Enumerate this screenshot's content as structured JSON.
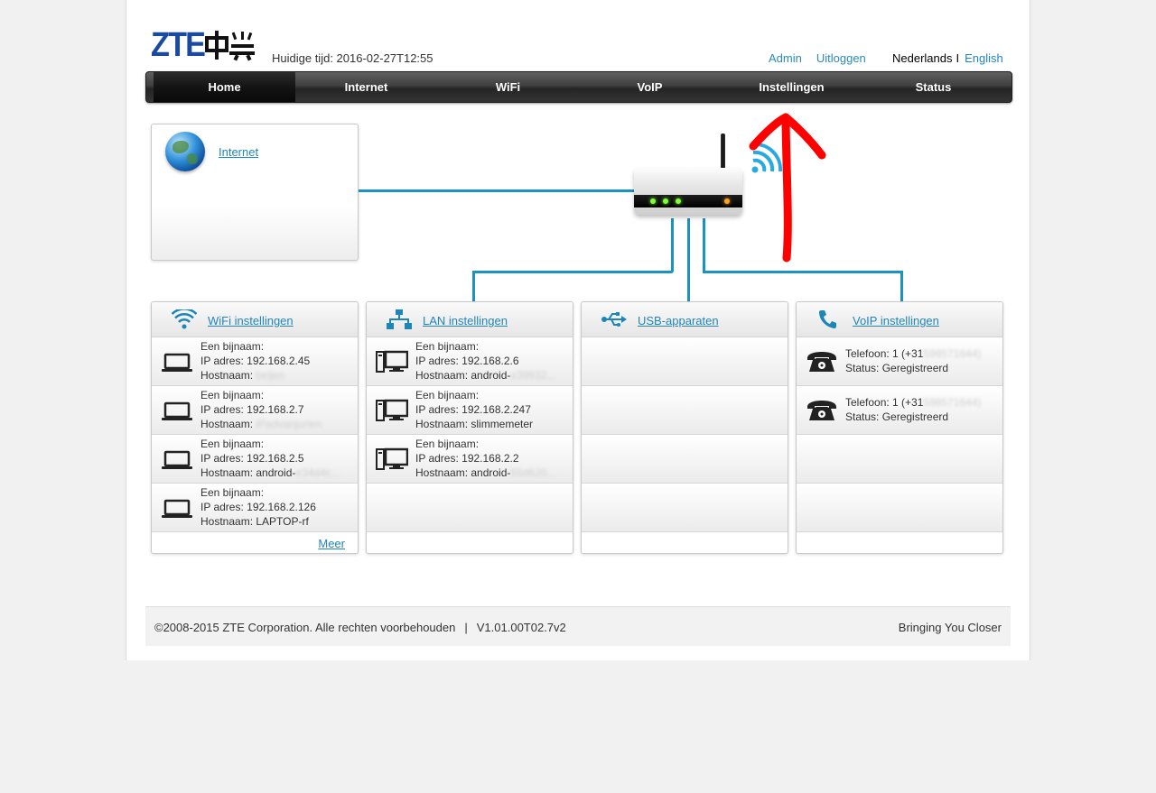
{
  "header": {
    "time": "Huidige tijd: 2016-02-27T12:55",
    "links": [
      "Admin",
      "Uitloggen"
    ],
    "lang_nl": "Nederlands",
    "lang_sep": "I",
    "lang_en": "English"
  },
  "nav": [
    "Home",
    "Internet",
    "WiFi",
    "VoIP",
    "Instellingen",
    "Status"
  ],
  "internet": {
    "label": "Internet"
  },
  "wifi": {
    "title": "WiFi instellingen",
    "rows": [
      {
        "name": "Een bijnaam:",
        "ip": "IP adres: 192.168.2.45",
        "host": "Hostnaam: ",
        "host_blur": "beijen"
      },
      {
        "name": "Een bijnaam:",
        "ip": "IP adres: 192.168.2.7",
        "host": "Hostnaam: ",
        "host_blur": "iPadvanjurien"
      },
      {
        "name": "Een bijnaam:",
        "ip": "IP adres: 192.168.2.5",
        "host": "Hostnaam: android-",
        "host_blur": "e34d4c..."
      },
      {
        "name": "Een bijnaam:",
        "ip": "IP adres: 192.168.2.126",
        "host": "Hostnaam: LAPTOP-rf",
        "host_blur": ""
      }
    ],
    "more": "Meer"
  },
  "lan": {
    "title": "LAN instellingen",
    "rows": [
      {
        "name": "Een bijnaam:",
        "ip": "IP adres: 192.168.2.6",
        "host": "Hostnaam: android-",
        "host_blur": "e39932..."
      },
      {
        "name": "Een bijnaam:",
        "ip": "IP adres: 192.168.2.247",
        "host": "Hostnaam: slimmemeter",
        "host_blur": ""
      },
      {
        "name": "Een bijnaam:",
        "ip": "IP adres: 192.168.2.2",
        "host": "Hostnaam: android-",
        "host_blur": "55d620..."
      }
    ]
  },
  "usb": {
    "title": "USB-apparaten"
  },
  "voip": {
    "title": "VoIP instellingen",
    "rows": [
      {
        "phone": "Telefoon: 1 (+31",
        "phone_blur": "598571644)",
        "status": "Status: Geregistreerd"
      },
      {
        "phone": "Telefoon: 1 (+31",
        "phone_blur": "598571644)",
        "status": "Status: Geregistreerd"
      }
    ]
  },
  "footer": {
    "copyright": "©2008-2015 ZTE Corporation. Alle rechten voorbehouden",
    "sep": "|",
    "version": "V1.01.00T02.7v2",
    "slogan": "Bringing You Closer"
  },
  "colors": {
    "link": "#2185bd",
    "line": "#1b92c4",
    "logo": "#1a4aa0",
    "annotation": "#ff0000"
  }
}
